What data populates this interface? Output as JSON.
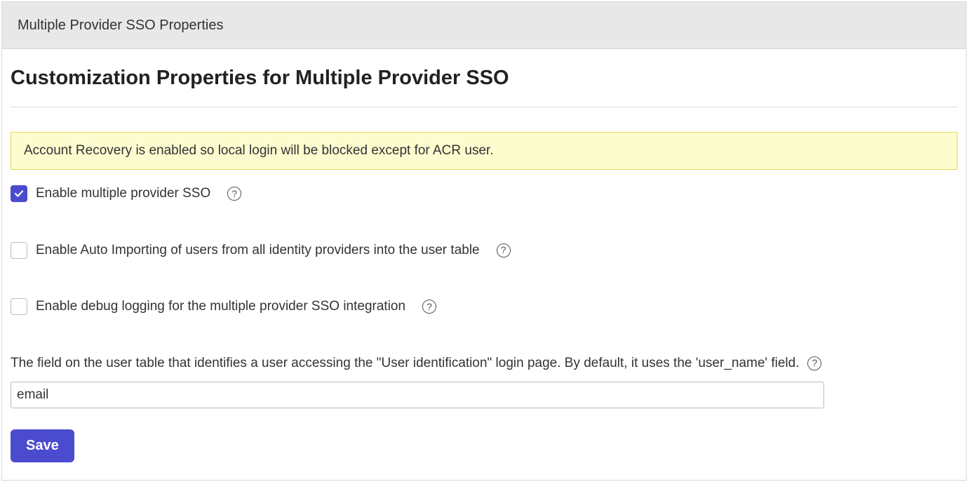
{
  "colors": {
    "accent": "#4b4bcf",
    "notice_bg": "#fdfccf",
    "notice_border": "#e5d65a"
  },
  "header": {
    "title": "Multiple Provider SSO Properties"
  },
  "page": {
    "title": "Customization Properties for Multiple Provider SSO"
  },
  "notice": {
    "text": "Account Recovery is enabled so local login will be blocked except for ACR user."
  },
  "fields": {
    "enable_sso": {
      "label": "Enable multiple provider SSO",
      "checked": true
    },
    "auto_import": {
      "label": "Enable Auto Importing of users from all identity providers into the user table",
      "checked": false
    },
    "debug_logging": {
      "label": "Enable debug logging for the multiple provider SSO integration",
      "checked": false
    },
    "user_field": {
      "label": "The field on the user table that identifies a user accessing the \"User identification\" login page. By default, it uses the 'user_name' field.",
      "value": "email"
    }
  },
  "buttons": {
    "save": "Save"
  }
}
